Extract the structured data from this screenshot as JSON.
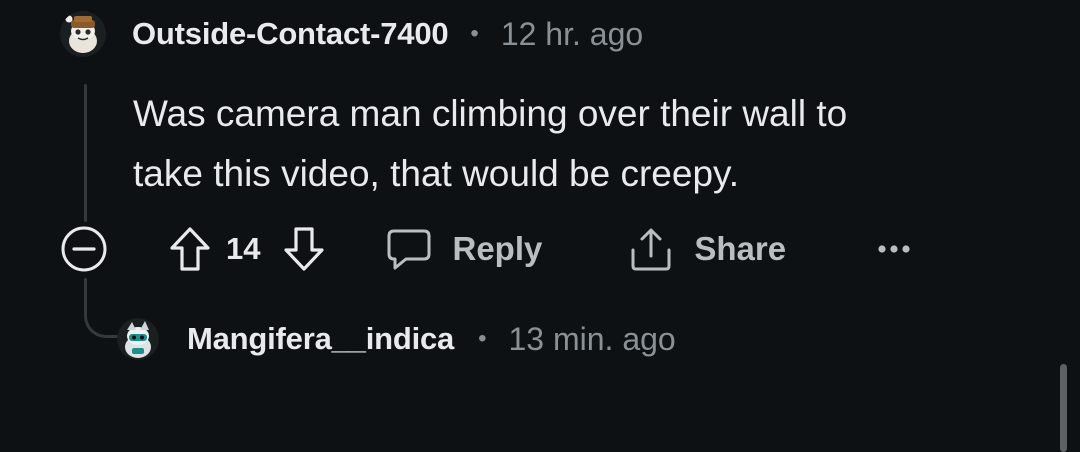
{
  "comment": {
    "username": "Outside-Contact-7400",
    "separator": "•",
    "timestamp": "12 hr. ago",
    "body_line1": "Was camera man climbing over their wall to",
    "body_line2": "take this video, that would be creepy.",
    "score": "14",
    "reply_label": "Reply",
    "share_label": "Share",
    "avatar_icon": "snoo-avatar-icon"
  },
  "reply": {
    "username": "Mangifera__indica",
    "separator": "•",
    "timestamp": "13 min. ago",
    "avatar_icon": "snoo-avatar-icon"
  },
  "icons": {
    "collapse": "minus-circle-icon",
    "upvote": "arrow-up-icon",
    "downvote": "arrow-down-icon",
    "reply": "speech-bubble-icon",
    "share": "share-icon",
    "more": "ellipsis-icon"
  },
  "colors": {
    "background": "#0e1113",
    "text": "#e8eaed",
    "muted": "#8a9196",
    "action": "#b9bec2"
  }
}
